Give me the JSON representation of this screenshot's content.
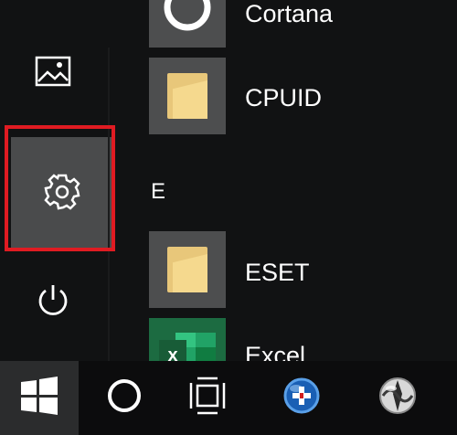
{
  "start_menu": {
    "rail": {
      "pictures_icon": "pictures-icon",
      "settings_icon": "gear-icon",
      "power_icon": "power-icon"
    },
    "section_letter": "E",
    "apps": [
      {
        "label": "Cortana",
        "icon": "cortana-ring-icon"
      },
      {
        "label": "CPUID",
        "icon": "folder-icon"
      },
      {
        "label": "ESET",
        "icon": "folder-icon"
      },
      {
        "label": "Excel",
        "icon": "excel-icon"
      }
    ]
  },
  "taskbar": {
    "start_icon": "windows-logo-icon",
    "cortana_icon": "cortana-circle-icon",
    "task_view_icon": "task-view-icon",
    "pinned": [
      "blue-medical-cross-app-icon",
      "compass-globe-app-icon"
    ]
  },
  "colors": {
    "highlight": "#e01b22",
    "menu_bg": "#111213",
    "tile_bg": "#4d4e4f",
    "excel_green": "#1c6b41",
    "folder": "#f5d98e"
  }
}
